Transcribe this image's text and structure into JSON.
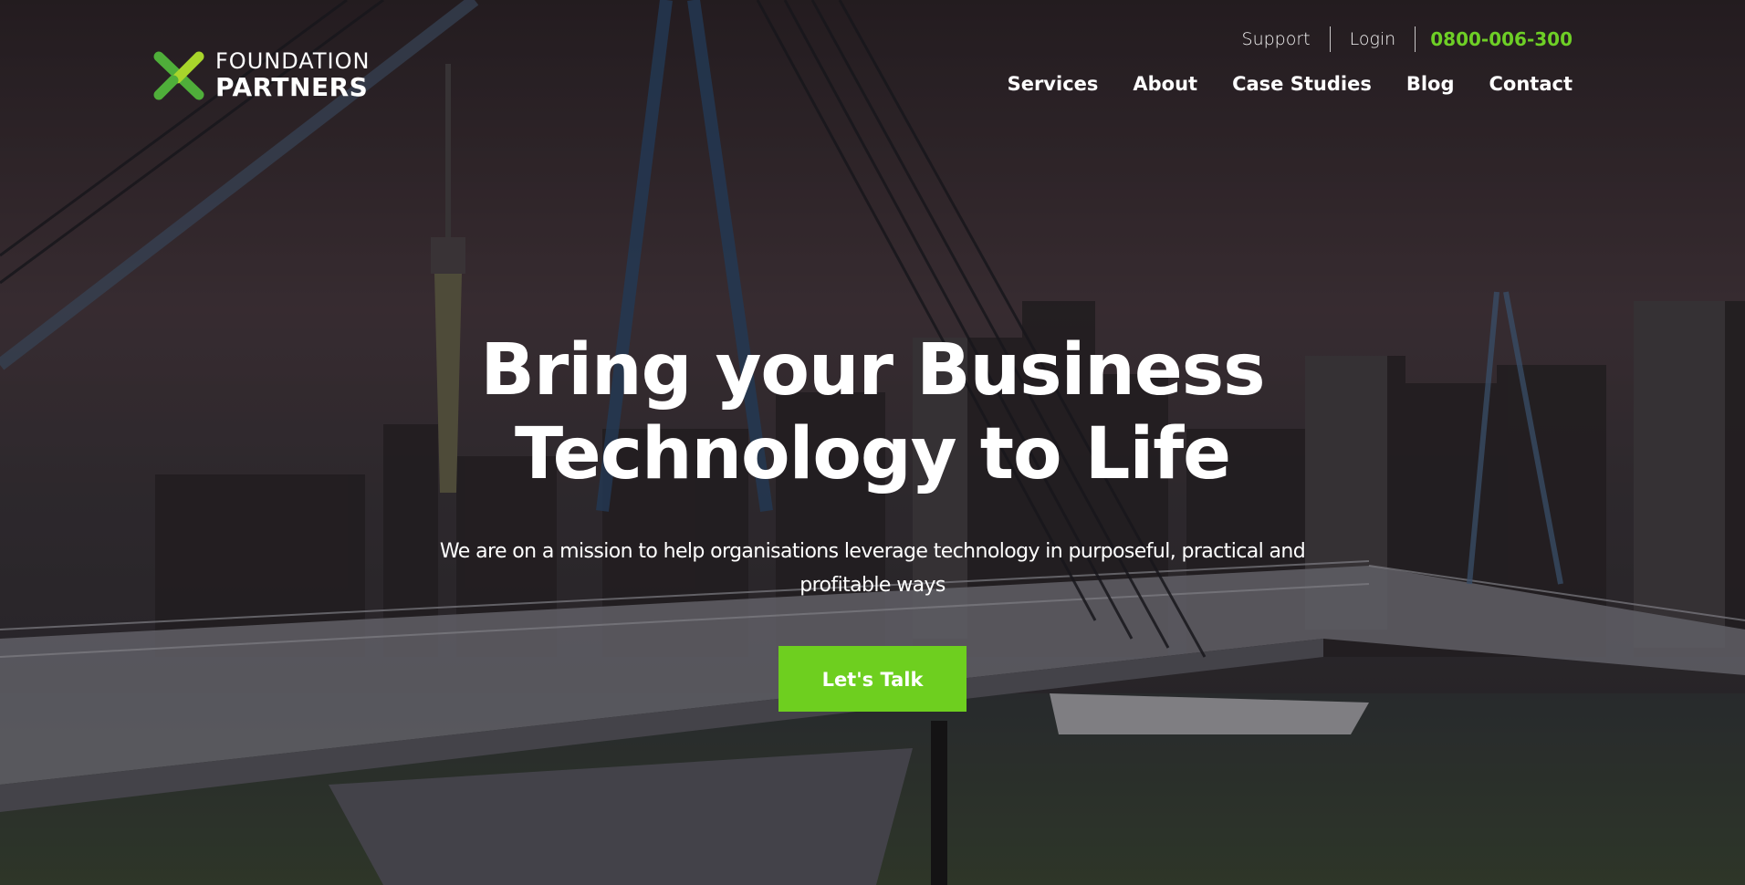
{
  "brand": {
    "name_line1": "FOUNDATION",
    "name_line2": "PARTNERS",
    "logo_icon": "x-mark-logo-icon",
    "colors": {
      "accent_green": "#6ecf1f",
      "logo_dark_green": "#4fae3a",
      "logo_light_green": "#a8d52b",
      "text": "#ffffff"
    }
  },
  "topbar": {
    "support": "Support",
    "login": "Login",
    "phone": "0800-006-300"
  },
  "nav": {
    "items": [
      {
        "label": "Services"
      },
      {
        "label": "About"
      },
      {
        "label": "Case Studies"
      },
      {
        "label": "Blog"
      },
      {
        "label": "Contact"
      }
    ]
  },
  "hero": {
    "title_line1": "Bring your Business",
    "title_line2": "Technology to Life",
    "subtitle_line1": "We are on a mission to help organisations leverage technology in purposeful, practical and",
    "subtitle_line2": "profitable ways",
    "cta_label": "Let's Talk",
    "background": "city-skyline-bridge-photo"
  }
}
